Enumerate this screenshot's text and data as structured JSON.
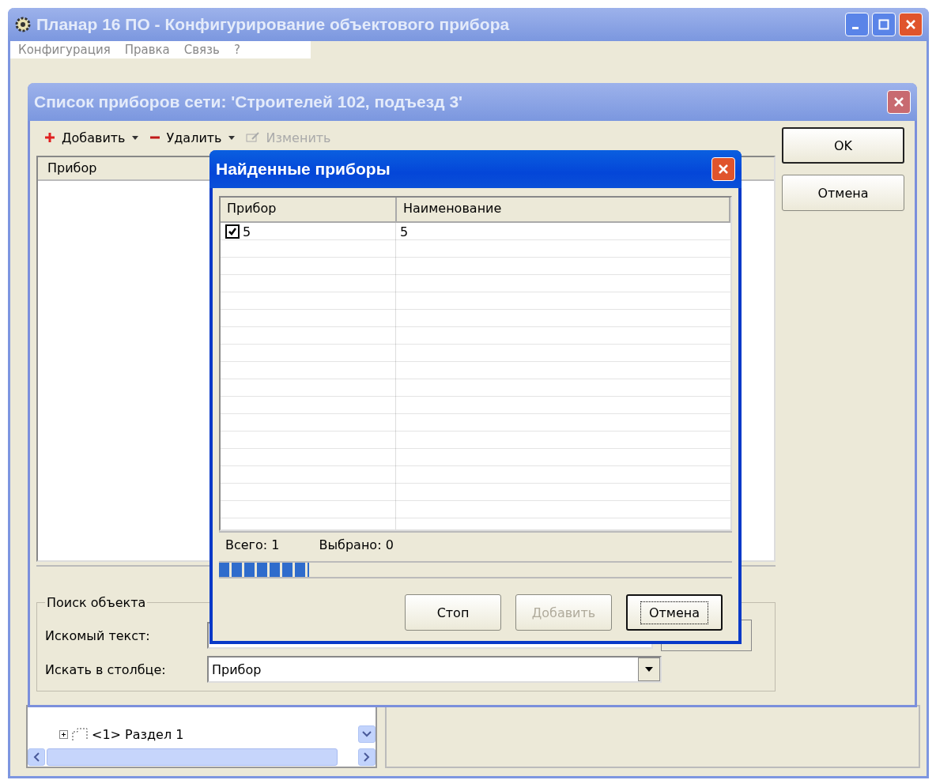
{
  "main_window": {
    "title": "Планар 16 ПО - Конфигурирование объектового прибора",
    "menu": [
      "Конфигурация",
      "Правка",
      "Связь",
      "?"
    ],
    "tree": [
      {
        "label": "<1> Раздел 1",
        "expanded": false
      }
    ]
  },
  "network_window": {
    "title": "Список приборов сети: 'Строителей  102, подъезд 3'",
    "toolbar": [
      {
        "label": "Добавить",
        "kind": "add",
        "disabled": false
      },
      {
        "label": "Удалить",
        "kind": "delete",
        "disabled": false
      },
      {
        "label": "Изменить",
        "kind": "edit",
        "disabled": true
      }
    ],
    "columns": [
      "Прибор"
    ],
    "search": {
      "title": "Поиск объекта",
      "text_label": "Искомый текст:",
      "column_label": "Искать в столбце:",
      "column_value": "Прибор"
    },
    "buttons": [
      "OK",
      "Отмена"
    ]
  },
  "found_dialog": {
    "title": "Найденные приборы",
    "columns": [
      "Прибор",
      "Наименование"
    ],
    "rows": [
      {
        "device": "5",
        "name": "5",
        "checked": true
      }
    ],
    "status": [
      "Всего: 1",
      "Выбрано: 0"
    ],
    "progress": {
      "level": 0.175
    },
    "buttons": [
      {
        "label": "Стоп",
        "disabled": false,
        "focused": false
      },
      {
        "label": "Добавить",
        "disabled": true,
        "focused": false
      },
      {
        "label": "Отмена",
        "disabled": false,
        "focused": true
      }
    ]
  }
}
